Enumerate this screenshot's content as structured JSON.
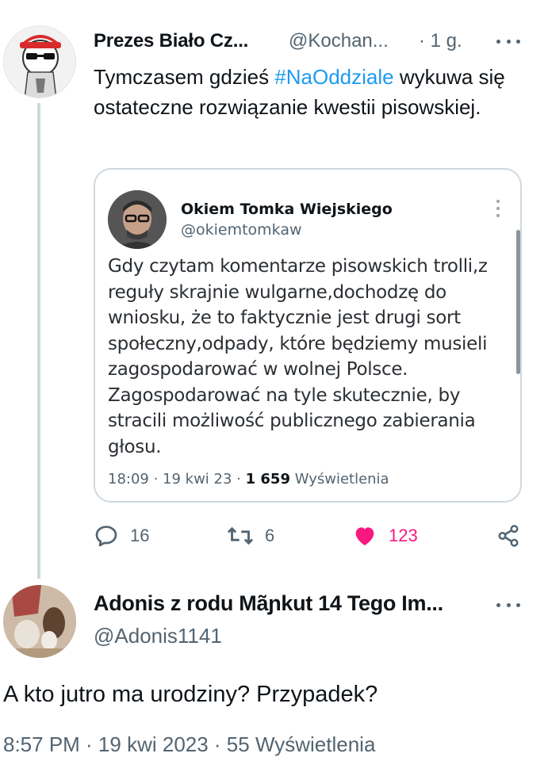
{
  "tweet1": {
    "author_name": "Prezes Biało Cz...",
    "handle": "@Kochan...",
    "time": "· 1 g.",
    "text_before": "Tymczasem gdzieś ",
    "hashtag": "#NaOddziale",
    "text_after": " wykuwa się ostateczne rozwiązanie kwestii pisowskiej."
  },
  "quoted": {
    "author_name": "Okiem Tomka Wiejskiego",
    "handle": "@okiemtomkaw",
    "text": "Gdy czytam komentarze pisowskich trolli,z reguły skrajnie wulgarne,dochodzę do wniosku, że to faktycznie jest drugi sort społeczny,odpady, które będziemy musieli zagospodarować w wolnej Polsce. Zagospodarować na tyle skutecznie, by stracili możliwość publicznego zabierania głosu.",
    "timestamp": "18:09 · 19 kwi 23 · ",
    "views": "1 659",
    "views_label": " Wyświetlenia"
  },
  "actions": {
    "replies": "16",
    "retweets": "6",
    "likes": "123"
  },
  "tweet2": {
    "author_name": "Adonis z rodu Mãɲkut 14 Tego Im...",
    "handle": "@Adonis1141",
    "text": "A kto jutro ma urodziny? Przypadek?",
    "meta": "8:57 PM · 19 kwi 2023 · 55 Wyświetlenia"
  },
  "colors": {
    "accent": "#1d9bf0",
    "like": "#f91880",
    "secondary_text": "#536471",
    "border": "#cfd9de"
  }
}
